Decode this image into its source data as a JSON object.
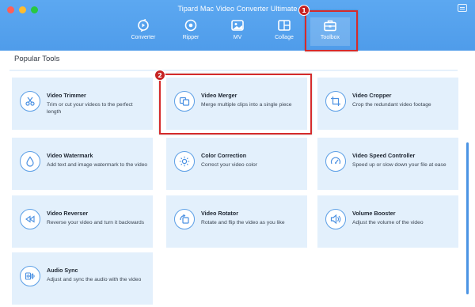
{
  "window": {
    "title": "Tipard Mac Video Converter Ultimate"
  },
  "nav": {
    "items": [
      {
        "label": "Converter",
        "icon": "converter-icon",
        "active": false
      },
      {
        "label": "Ripper",
        "icon": "ripper-icon",
        "active": false
      },
      {
        "label": "MV",
        "icon": "mv-icon",
        "active": false
      },
      {
        "label": "Collage",
        "icon": "collage-icon",
        "active": false
      },
      {
        "label": "Toolbox",
        "icon": "toolbox-icon",
        "active": true
      }
    ]
  },
  "callouts": [
    "1",
    "2"
  ],
  "section": {
    "title": "Popular Tools"
  },
  "tools": [
    {
      "name": "Video Trimmer",
      "desc": "Trim or cut your videos to the perfect length",
      "icon": "scissors-icon"
    },
    {
      "name": "Video Merger",
      "desc": "Merge multiple clips into a single piece",
      "icon": "merge-icon"
    },
    {
      "name": "Video Cropper",
      "desc": "Crop the redundant video footage",
      "icon": "crop-icon"
    },
    {
      "name": "Video Watermark",
      "desc": "Add text and image watermark to the video",
      "icon": "droplet-icon"
    },
    {
      "name": "Color Correction",
      "desc": "Correct your video color",
      "icon": "sun-icon"
    },
    {
      "name": "Video Speed Controller",
      "desc": "Speed up or slow down your file at ease",
      "icon": "speedometer-icon"
    },
    {
      "name": "Video Reverser",
      "desc": "Reverse your video and turn it backwards",
      "icon": "rewind-icon"
    },
    {
      "name": "Video Rotator",
      "desc": "Rotate and flip the video as you like",
      "icon": "rotate-icon"
    },
    {
      "name": "Volume Booster",
      "desc": "Adjust the volume of the video",
      "icon": "speaker-icon"
    },
    {
      "name": "Audio Sync",
      "desc": "Adjust and sync the audio with the video",
      "icon": "audio-sync-icon"
    }
  ],
  "colors": {
    "toolbar": "#4f9cea",
    "card": "#e3f0fc",
    "icon_outline": "#5c9fe6",
    "callout": "#d52b2b"
  }
}
